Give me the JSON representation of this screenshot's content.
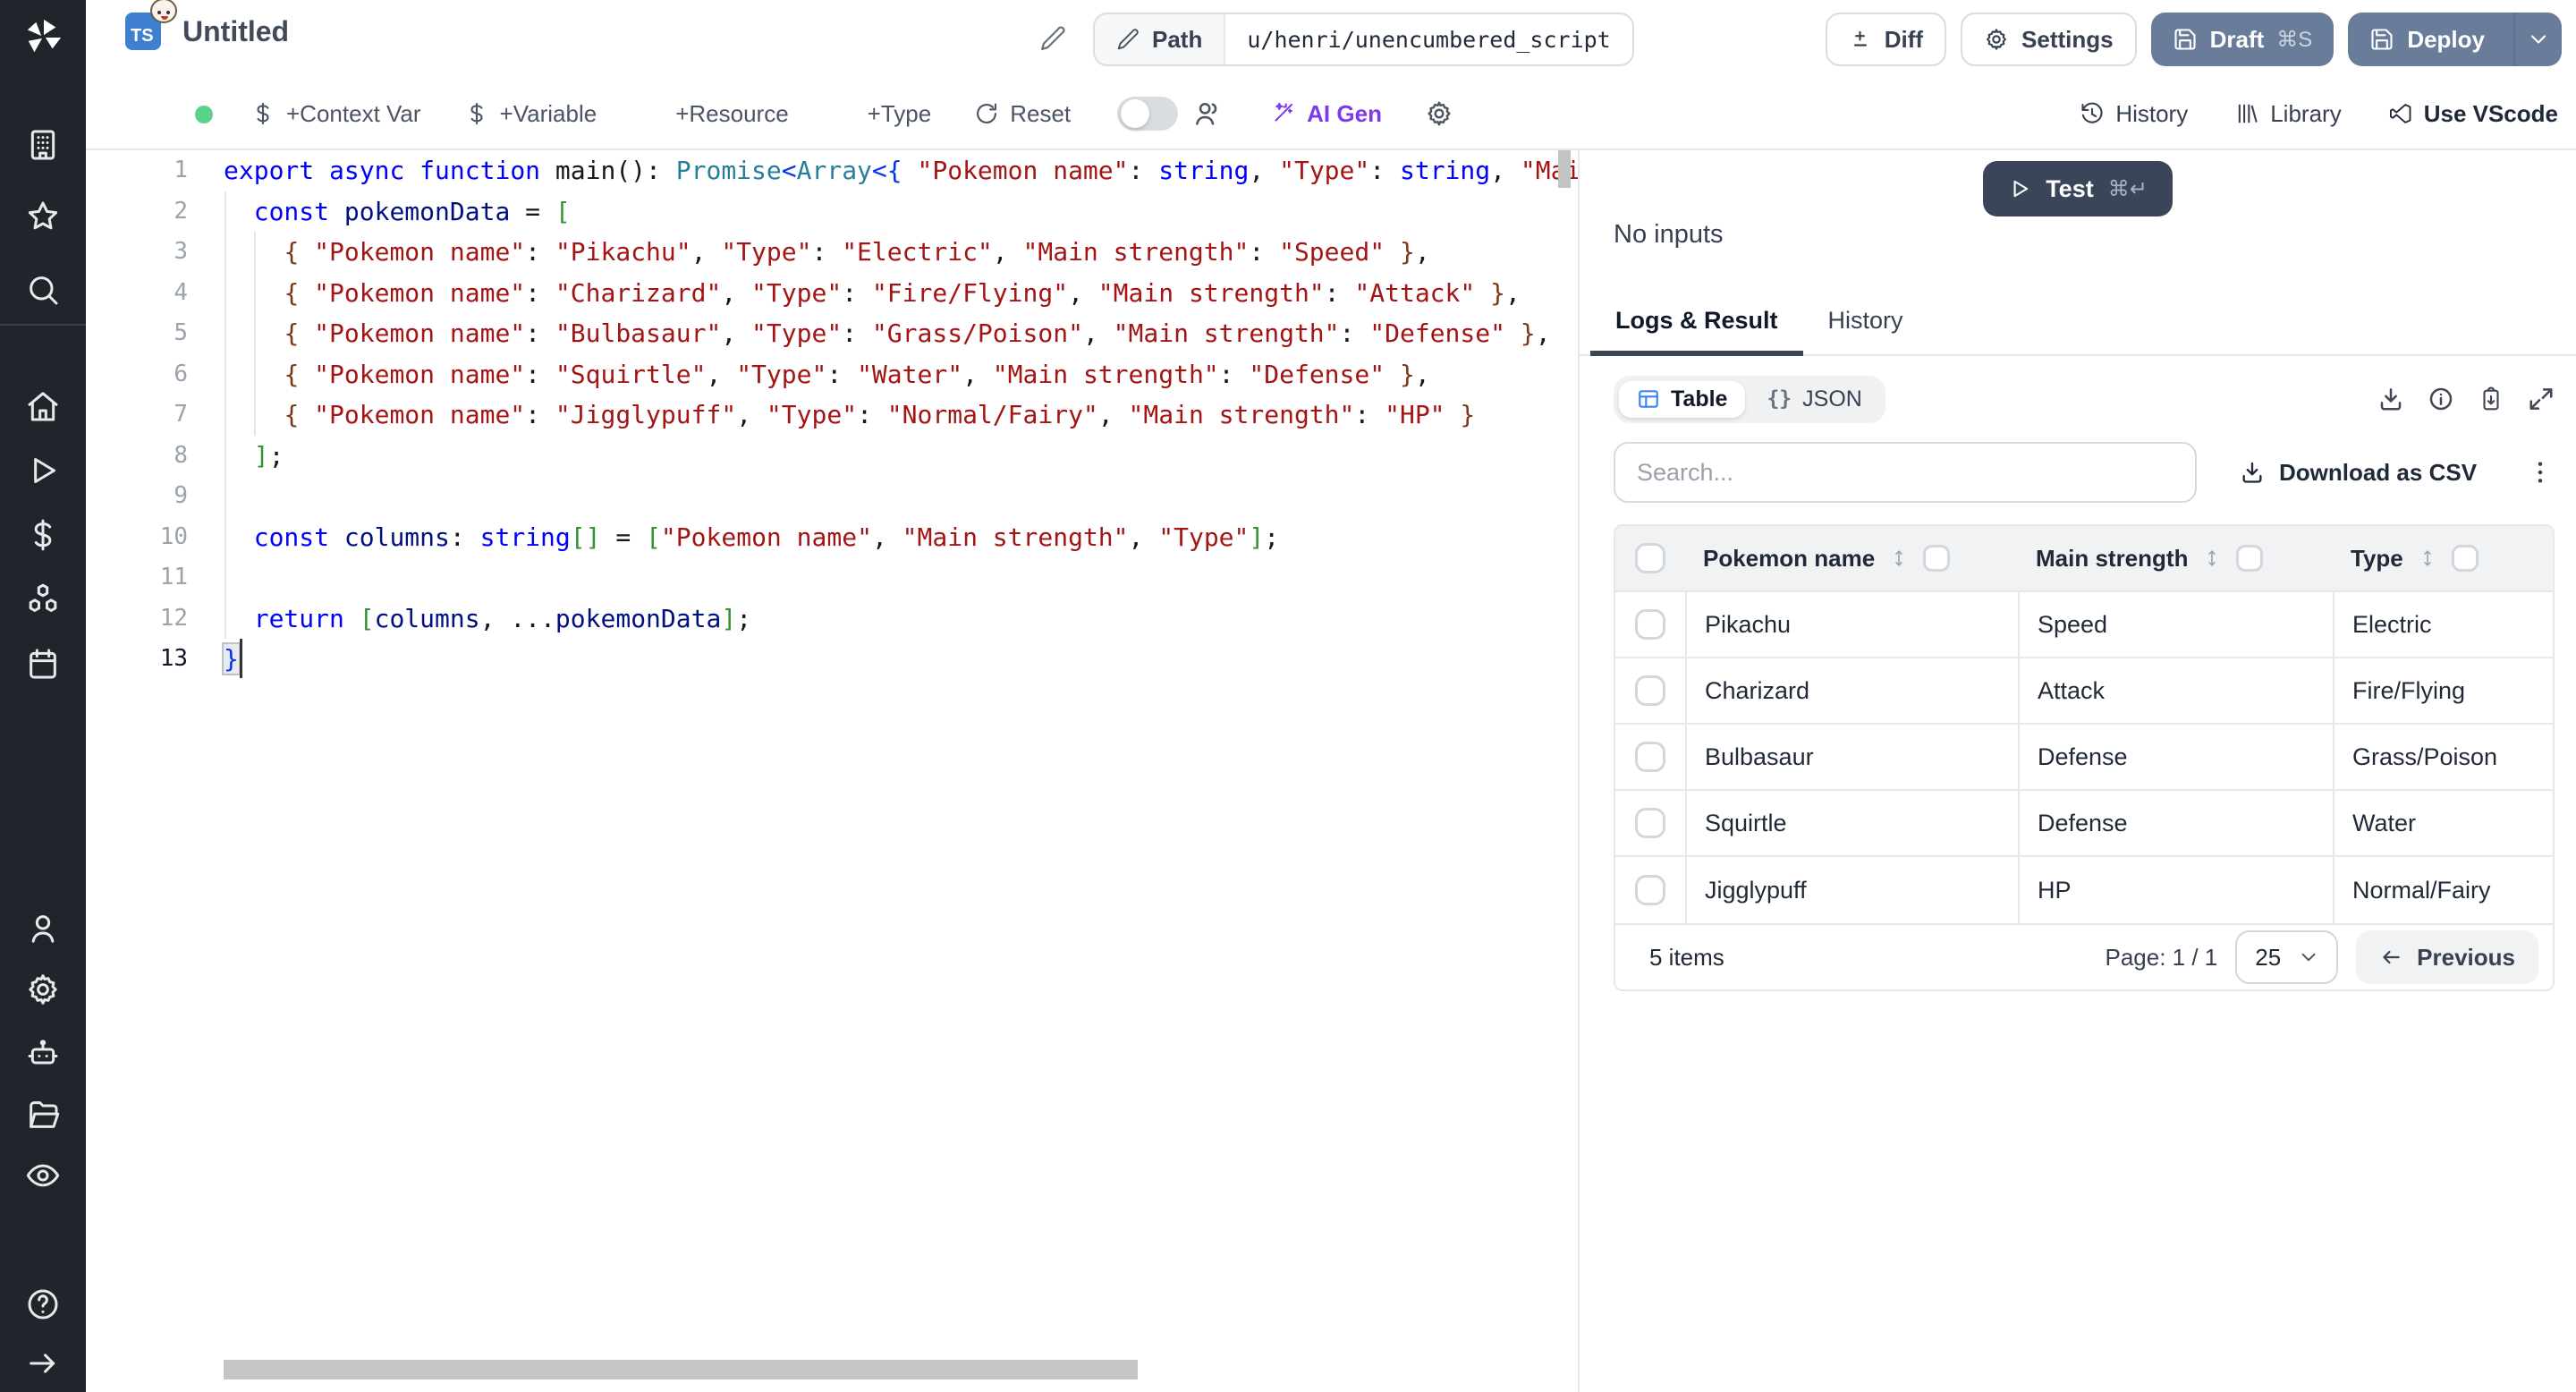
{
  "app": {
    "name": "Windmill script editor"
  },
  "colors": {
    "sidebar_bg": "#20242b",
    "steel_button": "#697d9b",
    "test_button": "#3a4559",
    "ts_badge_blue": "#3e7fd0",
    "ai_gen_purple": "#7c3aed",
    "status_green": "#5bd389",
    "table_icon_blue": "#3b82f6",
    "code_keyword": "#0000ff",
    "code_type": "#267f99",
    "code_string": "#a31515",
    "code_bracket_blue": "#0431fa",
    "code_bracket_green": "#319331",
    "code_bracket_brown": "#7b3814"
  },
  "sidebar": {
    "icons": [
      "windmill-logo",
      "building-icon",
      "star-icon",
      "search-icon",
      "home-icon",
      "play-icon",
      "dollar-icon",
      "boxes-icon",
      "calendar-icon",
      "user-icon",
      "gear-icon",
      "robot-icon",
      "folder-icon",
      "eye-icon",
      "help-icon",
      "arrow-right-icon"
    ]
  },
  "header": {
    "ts_badge": "TS",
    "title": "Untitled",
    "path_label": "Path",
    "path_value": "u/henri/unencumbered_script",
    "diff_label": "Diff",
    "settings_label": "Settings",
    "draft_label": "Draft",
    "draft_kbd": "⌘S",
    "deploy_label": "Deploy"
  },
  "toolbar": {
    "left": [
      {
        "icon": "dollar",
        "label": "+Context Var"
      },
      {
        "icon": "dollar",
        "label": "+Variable"
      },
      {
        "icon": "package",
        "label": "+Resource"
      },
      {
        "icon": "package",
        "label": "+Type"
      },
      {
        "icon": "reset",
        "label": "Reset"
      }
    ],
    "ai_gen_label": "AI Gen",
    "right": [
      {
        "icon": "history",
        "label": "History"
      },
      {
        "icon": "library",
        "label": "Library"
      },
      {
        "icon": "vscode",
        "label": "Use VScode"
      }
    ]
  },
  "editor": {
    "active_line": 13,
    "lines": [
      {
        "n": 1,
        "tokens": [
          [
            "k",
            "export "
          ],
          [
            "k",
            "async "
          ],
          [
            "k",
            "function "
          ],
          [
            "d",
            "main(): "
          ],
          [
            "t",
            "Promise"
          ],
          [
            "b1",
            "<"
          ],
          [
            "t",
            "Array"
          ],
          [
            "b1",
            "<"
          ],
          [
            "b1",
            "{ "
          ],
          [
            "s",
            "\"Pokemon name\""
          ],
          [
            "d",
            ": "
          ],
          [
            "k",
            "string"
          ],
          [
            "d",
            ", "
          ],
          [
            "s",
            "\"Type\""
          ],
          [
            "d",
            ": "
          ],
          [
            "k",
            "string"
          ],
          [
            "d",
            ", "
          ],
          [
            "s",
            "\"Mai"
          ]
        ]
      },
      {
        "n": 2,
        "tokens": [
          [
            "d",
            "  "
          ],
          [
            "k",
            "const"
          ],
          [
            "d",
            " "
          ],
          [
            "v",
            "pokemonData"
          ],
          [
            "d",
            " = "
          ],
          [
            "b2",
            "["
          ]
        ]
      },
      {
        "n": 3,
        "tokens": [
          [
            "d",
            "    "
          ],
          [
            "b3",
            "{ "
          ],
          [
            "s",
            "\"Pokemon name\""
          ],
          [
            "d",
            ": "
          ],
          [
            "s",
            "\"Pikachu\""
          ],
          [
            "d",
            ", "
          ],
          [
            "s",
            "\"Type\""
          ],
          [
            "d",
            ": "
          ],
          [
            "s",
            "\"Electric\""
          ],
          [
            "d",
            ", "
          ],
          [
            "s",
            "\"Main strength\""
          ],
          [
            "d",
            ": "
          ],
          [
            "s",
            "\"Speed\""
          ],
          [
            "b3",
            " }"
          ],
          [
            "d",
            ","
          ]
        ]
      },
      {
        "n": 4,
        "tokens": [
          [
            "d",
            "    "
          ],
          [
            "b3",
            "{ "
          ],
          [
            "s",
            "\"Pokemon name\""
          ],
          [
            "d",
            ": "
          ],
          [
            "s",
            "\"Charizard\""
          ],
          [
            "d",
            ", "
          ],
          [
            "s",
            "\"Type\""
          ],
          [
            "d",
            ": "
          ],
          [
            "s",
            "\"Fire/Flying\""
          ],
          [
            "d",
            ", "
          ],
          [
            "s",
            "\"Main strength\""
          ],
          [
            "d",
            ": "
          ],
          [
            "s",
            "\"Attack\""
          ],
          [
            "b3",
            " }"
          ],
          [
            "d",
            ","
          ]
        ]
      },
      {
        "n": 5,
        "tokens": [
          [
            "d",
            "    "
          ],
          [
            "b3",
            "{ "
          ],
          [
            "s",
            "\"Pokemon name\""
          ],
          [
            "d",
            ": "
          ],
          [
            "s",
            "\"Bulbasaur\""
          ],
          [
            "d",
            ", "
          ],
          [
            "s",
            "\"Type\""
          ],
          [
            "d",
            ": "
          ],
          [
            "s",
            "\"Grass/Poison\""
          ],
          [
            "d",
            ", "
          ],
          [
            "s",
            "\"Main strength\""
          ],
          [
            "d",
            ": "
          ],
          [
            "s",
            "\"Defense\""
          ],
          [
            "b3",
            " }"
          ],
          [
            "d",
            ","
          ]
        ]
      },
      {
        "n": 6,
        "tokens": [
          [
            "d",
            "    "
          ],
          [
            "b3",
            "{ "
          ],
          [
            "s",
            "\"Pokemon name\""
          ],
          [
            "d",
            ": "
          ],
          [
            "s",
            "\"Squirtle\""
          ],
          [
            "d",
            ", "
          ],
          [
            "s",
            "\"Type\""
          ],
          [
            "d",
            ": "
          ],
          [
            "s",
            "\"Water\""
          ],
          [
            "d",
            ", "
          ],
          [
            "s",
            "\"Main strength\""
          ],
          [
            "d",
            ": "
          ],
          [
            "s",
            "\"Defense\""
          ],
          [
            "b3",
            " }"
          ],
          [
            "d",
            ","
          ]
        ]
      },
      {
        "n": 7,
        "tokens": [
          [
            "d",
            "    "
          ],
          [
            "b3",
            "{ "
          ],
          [
            "s",
            "\"Pokemon name\""
          ],
          [
            "d",
            ": "
          ],
          [
            "s",
            "\"Jigglypuff\""
          ],
          [
            "d",
            ", "
          ],
          [
            "s",
            "\"Type\""
          ],
          [
            "d",
            ": "
          ],
          [
            "s",
            "\"Normal/Fairy\""
          ],
          [
            "d",
            ", "
          ],
          [
            "s",
            "\"Main strength\""
          ],
          [
            "d",
            ": "
          ],
          [
            "s",
            "\"HP\""
          ],
          [
            "b3",
            " }"
          ]
        ]
      },
      {
        "n": 8,
        "tokens": [
          [
            "d",
            "  "
          ],
          [
            "b2",
            "]"
          ],
          [
            "d",
            ";"
          ]
        ]
      },
      {
        "n": 9,
        "tokens": []
      },
      {
        "n": 10,
        "tokens": [
          [
            "d",
            "  "
          ],
          [
            "k",
            "const"
          ],
          [
            "d",
            " "
          ],
          [
            "v",
            "columns"
          ],
          [
            "d",
            ": "
          ],
          [
            "k",
            "string"
          ],
          [
            "b2",
            "[]"
          ],
          [
            "d",
            " = "
          ],
          [
            "b2",
            "["
          ],
          [
            "s",
            "\"Pokemon name\""
          ],
          [
            "d",
            ", "
          ],
          [
            "s",
            "\"Main strength\""
          ],
          [
            "d",
            ", "
          ],
          [
            "s",
            "\"Type\""
          ],
          [
            "b2",
            "]"
          ],
          [
            "d",
            ";"
          ]
        ]
      },
      {
        "n": 11,
        "tokens": []
      },
      {
        "n": 12,
        "tokens": [
          [
            "d",
            "  "
          ],
          [
            "k",
            "return"
          ],
          [
            "d",
            " "
          ],
          [
            "b2",
            "["
          ],
          [
            "v",
            "columns"
          ],
          [
            "d",
            ", ..."
          ],
          [
            "v",
            "pokemonData"
          ],
          [
            "b2",
            "]"
          ],
          [
            "d",
            ";"
          ]
        ]
      },
      {
        "n": 13,
        "tokens": [
          [
            "m",
            "}"
          ]
        ]
      }
    ]
  },
  "run": {
    "test_label": "Test",
    "test_kbd": "⌘↵",
    "no_inputs": "No inputs"
  },
  "tabs": {
    "items": [
      "Logs & Result",
      "History"
    ],
    "active": "Logs & Result"
  },
  "result": {
    "view_table": "Table",
    "view_json": "JSON",
    "json_glyph": "{}",
    "search_placeholder": "Search...",
    "download_csv": "Download as CSV"
  },
  "table": {
    "columns": [
      "Pokemon name",
      "Main strength",
      "Type"
    ],
    "rows": [
      [
        "Pikachu",
        "Speed",
        "Electric"
      ],
      [
        "Charizard",
        "Attack",
        "Fire/Flying"
      ],
      [
        "Bulbasaur",
        "Defense",
        "Grass/Poison"
      ],
      [
        "Squirtle",
        "Defense",
        "Water"
      ],
      [
        "Jigglypuff",
        "HP",
        "Normal/Fairy"
      ]
    ],
    "footer": {
      "count": "5 items",
      "page": "Page: 1 / 1",
      "page_size": "25",
      "previous": "Previous"
    }
  }
}
